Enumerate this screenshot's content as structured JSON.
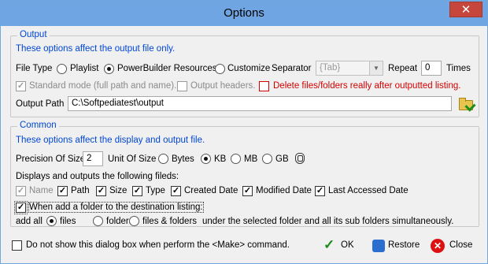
{
  "window": {
    "title": "Options",
    "close_glyph": "✕"
  },
  "output": {
    "legend": "Output",
    "note": "These options affect the output file only.",
    "file_type_label": "File Type",
    "file_types": [
      "Playlist",
      "PowerBuilder Resources",
      "Customize"
    ],
    "file_type_selected": "PowerBuilder Resources",
    "separator_label": "Separator",
    "separator_value": "{Tab}",
    "repeat_label": "Repeat",
    "repeat_value": "0",
    "times_label": "Times",
    "standard_mode_label": "Standard mode (full path and name).",
    "standard_mode_checked": true,
    "output_headers_label": "Output headers.",
    "output_headers_checked": false,
    "delete_label": "Delete files/folders really after outputted listing.",
    "delete_checked": false,
    "output_path_label": "Output Path",
    "output_path_value": "C:\\Softpediatest\\output",
    "browse_icon": "folder-open-icon"
  },
  "common": {
    "legend": "Common",
    "note": "These options affect the display and output file.",
    "precision_label": "Precision Of Size",
    "precision_value": "2",
    "unit_label": "Unit Of Size",
    "units": [
      "Bytes",
      "KB",
      "MB",
      "GB"
    ],
    "unit_selected": "KB",
    "displays_label": "Displays and outputs the following fileds:",
    "fields": [
      {
        "label": "Name",
        "checked": true,
        "disabled": true
      },
      {
        "label": "Path",
        "checked": true,
        "disabled": false
      },
      {
        "label": "Size",
        "checked": true,
        "disabled": false
      },
      {
        "label": "Type",
        "checked": true,
        "disabled": false
      },
      {
        "label": "Created Date",
        "checked": true,
        "disabled": false
      },
      {
        "label": "Modified Date",
        "checked": true,
        "disabled": false
      },
      {
        "label": "Last Accessed Date",
        "checked": true,
        "disabled": false
      }
    ],
    "when_add_label": "When add a folder to the destination listing:",
    "when_add_checked": true,
    "add_all_label": "add all",
    "add_options": [
      "files",
      "folders",
      "files & folders"
    ],
    "add_selected": "files",
    "add_suffix": "under the selected folder and all its sub folders simultaneously."
  },
  "footer": {
    "dont_show_label": "Do not show this dialog box when perform the <Make> command.",
    "dont_show_checked": false,
    "ok_label": "OK",
    "restore_label": "Restore",
    "close_label": "Close"
  },
  "colors": {
    "titlebar": "#6ea5e2",
    "accent_text": "#0046d5",
    "danger_text": "#d40000"
  }
}
